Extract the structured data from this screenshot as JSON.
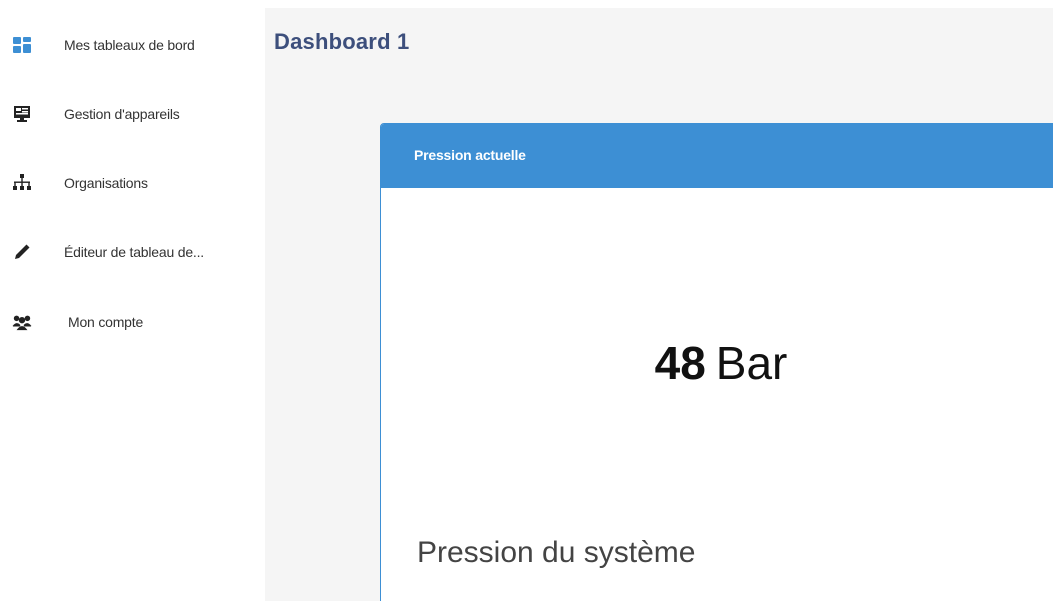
{
  "sidebar": {
    "items": [
      {
        "label": "Mes tableaux de bord",
        "icon": "dashboard-icon"
      },
      {
        "label": "Gestion d'appareils",
        "icon": "device-icon"
      },
      {
        "label": "Organisations",
        "icon": "org-tree-icon"
      },
      {
        "label": "Éditeur de tableau de...",
        "icon": "pencil-icon"
      },
      {
        "label": "Mon compte",
        "icon": "users-icon"
      }
    ]
  },
  "main": {
    "title": "Dashboard 1",
    "widget": {
      "title": "Pression actuelle",
      "value": "48",
      "unit": "Bar",
      "subtitle": "Pression du système"
    }
  },
  "colors": {
    "accent": "#3d8fd4",
    "title": "#3d4f7c",
    "background": "#f5f5f5"
  }
}
